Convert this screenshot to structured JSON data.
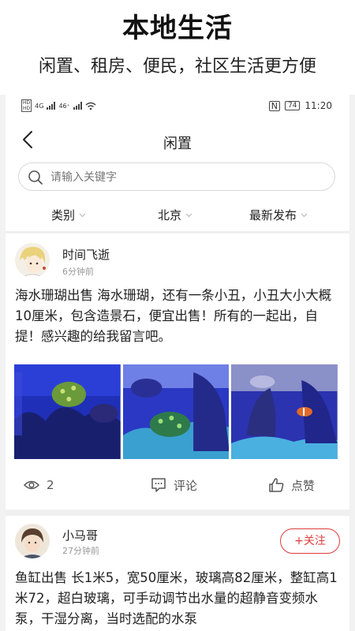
{
  "promo": {
    "title": "本地生活",
    "subtitle": "闲置、租房、便民，社区生活更方便"
  },
  "status_bar": {
    "network1": "4G",
    "network2": "46⁺",
    "nfc": "N",
    "battery": "74",
    "time": "11:20"
  },
  "nav": {
    "back_icon": "chevron-left-icon",
    "title": "闲置"
  },
  "search": {
    "placeholder": "请输入关键字"
  },
  "filters": [
    {
      "label": "类别"
    },
    {
      "label": "北京"
    },
    {
      "label": "最新发布"
    }
  ],
  "posts": [
    {
      "user": "时间飞逝",
      "time": "6分钟前",
      "text": "海水珊瑚出售 海水珊瑚，还有一条小丑，小丑大小大概10厘米，包含造景石，便宜出售！所有的一起出，自提！感兴趣的给我留言吧。",
      "views": "2",
      "comment_label": "评论",
      "like_label": "点赞"
    },
    {
      "user": "小马哥",
      "time": "27分钟前",
      "follow_label": "+关注",
      "text": "鱼缸出售 长1米5，宽50厘米，玻璃高82厘米，整缸高1米72，超白玻璃，可手动调节出水量的超静音变频水泵，干湿分离，当时选配的水泵"
    }
  ],
  "colors": {
    "accent": "#e03b3b",
    "aquarium_blue": "#2b3fd6"
  }
}
